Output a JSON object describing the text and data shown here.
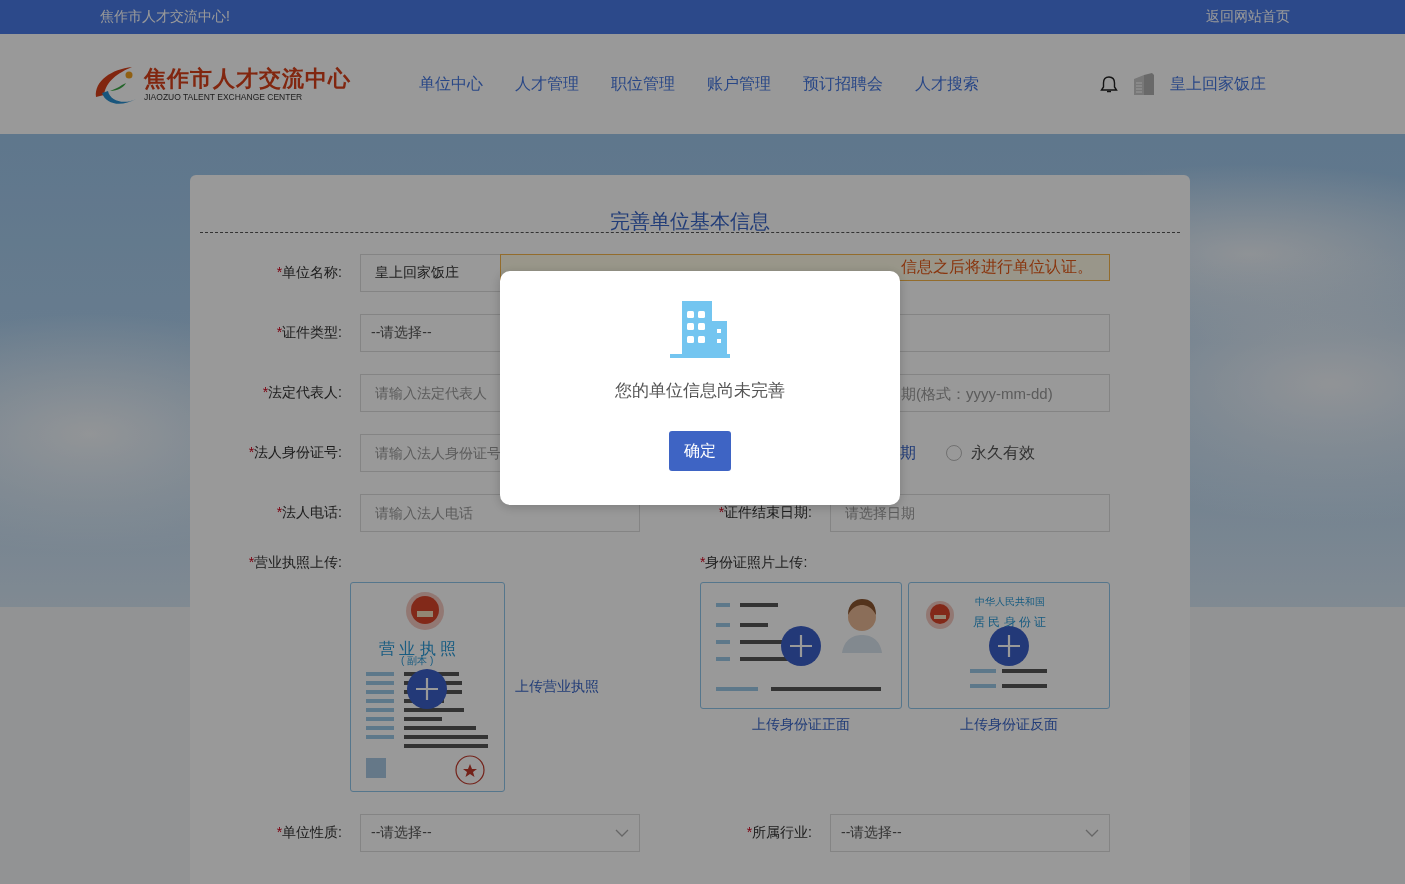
{
  "top_bar": {
    "welcome": "焦作市人才交流中心!",
    "home_link": "返回网站首页"
  },
  "header": {
    "logo_title": "焦作市人才交流中心",
    "logo_subtitle": "JIAOZUO TALENT EXCHANGE CENTER",
    "nav": [
      "单位中心",
      "人才管理",
      "职位管理",
      "账户管理",
      "预订招聘会",
      "人才搜索"
    ],
    "username": "皇上回家饭庄"
  },
  "form": {
    "title": "完善单位基本信息",
    "rows": [
      {
        "left": {
          "required_mark": "*",
          "label": "单位名称:",
          "kind": "input",
          "value": "皇上回家饭庄"
        },
        "right": {
          "kind": "notice",
          "text": "信息之后将进行单位认证。"
        }
      },
      {
        "left": {
          "required_mark": "*",
          "label": "证件类型:",
          "kind": "select",
          "value": "--请选择--"
        },
        "right": {
          "kind": "input"
        }
      },
      {
        "left": {
          "required_mark": "*",
          "label": "法定代表人:",
          "kind": "input",
          "placeholder": "请输入法定代表人"
        },
        "right": {
          "kind": "input",
          "placeholder": "期(格式：yyyy-mm-dd)"
        }
      },
      {
        "left": {
          "required_mark": "*",
          "label": "法人身份证号:",
          "kind": "input",
          "placeholder": "请输入法人身份证号"
        },
        "right": {
          "kind": "radios",
          "options": [
            {
              "label": "期",
              "selected": true
            },
            {
              "label": "永久有效",
              "selected": false
            }
          ]
        }
      },
      {
        "left": {
          "required_mark": "*",
          "label": "法人电话:",
          "kind": "input",
          "placeholder": "请输入法人电话"
        },
        "right": {
          "kind": "input",
          "required_mark": "*",
          "label": "证件结束日期:",
          "placeholder": "请选择日期"
        }
      }
    ],
    "uploads": {
      "license": {
        "required_mark": "*",
        "label": "营业执照上传:",
        "sample_title": "营 业 执 照",
        "sample_subtitle": "( 副本 )",
        "hint": "上传营业执照"
      },
      "id_card": {
        "required_mark": "*",
        "label": "身份证照片上传:",
        "back_title": "中华人民共和国",
        "back_subtitle": "居 民 身 份 证",
        "front_caption": "上传身份证正面",
        "back_caption": "上传身份证反面"
      }
    },
    "bottom_row": [
      {
        "required_mark": "*",
        "label": "单位性质:",
        "kind": "select",
        "value": "--请选择--",
        "arrow": true
      },
      {
        "required_mark": "*",
        "label": "所属行业:",
        "kind": "select",
        "value": "--请选择--",
        "arrow": true
      }
    ]
  },
  "modal": {
    "message": "您的单位信息尚未完善",
    "button": "确定"
  }
}
